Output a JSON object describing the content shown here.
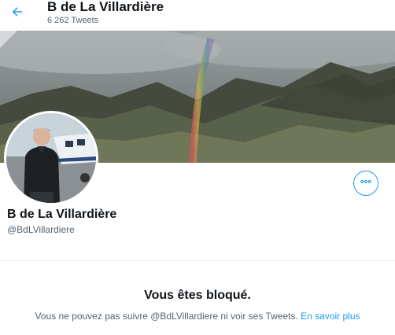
{
  "header": {
    "title": "B de La Villardière",
    "tweet_count": "6 262 Tweets",
    "back_icon": "arrow-left-icon"
  },
  "profile": {
    "display_name": "B de La Villardière",
    "handle": "@BdLVillardiere",
    "more_icon": "more-horizontal-icon"
  },
  "blocked": {
    "title": "Vous êtes bloqué.",
    "message": "Vous ne pouvez pas suivre @BdLVillardiere ni voir ses Tweets.",
    "learn_more": "En savoir plus"
  },
  "colors": {
    "accent": "#1d9bf0",
    "text_primary": "#0f1419",
    "text_secondary": "#536471"
  }
}
